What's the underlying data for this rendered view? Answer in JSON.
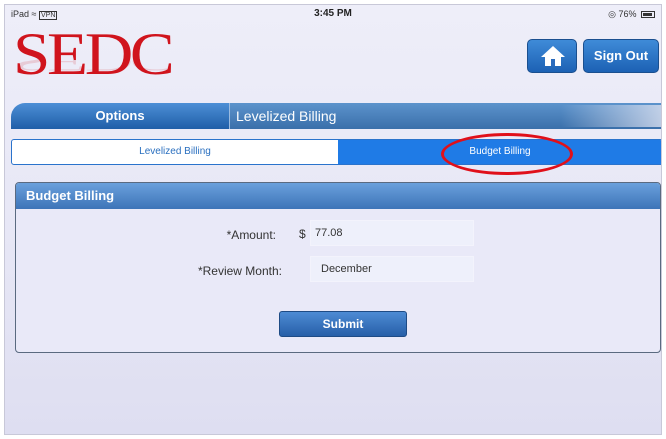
{
  "status_bar": {
    "device": "iPad",
    "vpn": "VPN",
    "time": "3:45 PM",
    "battery": "76%"
  },
  "logo": {
    "text": "SEDC"
  },
  "header": {
    "home_icon": "home-icon",
    "sign_out_label": "Sign Out"
  },
  "options_bar": {
    "options_label": "Options",
    "current_page": "Levelized Billing"
  },
  "segment": {
    "left_label": "Levelized Billing",
    "right_label": "Budget Billing",
    "selected": "Budget Billing"
  },
  "panel": {
    "title": "Budget Billing",
    "amount_label": "*Amount:",
    "currency_symbol": "$",
    "amount_value": "77.08",
    "review_month_label": "*Review Month:",
    "review_month_value": "December",
    "submit_label": "Submit"
  },
  "colors": {
    "brand_red": "#d0141d",
    "accent_blue": "#1f7be6",
    "highlight_red": "#e0101a"
  }
}
